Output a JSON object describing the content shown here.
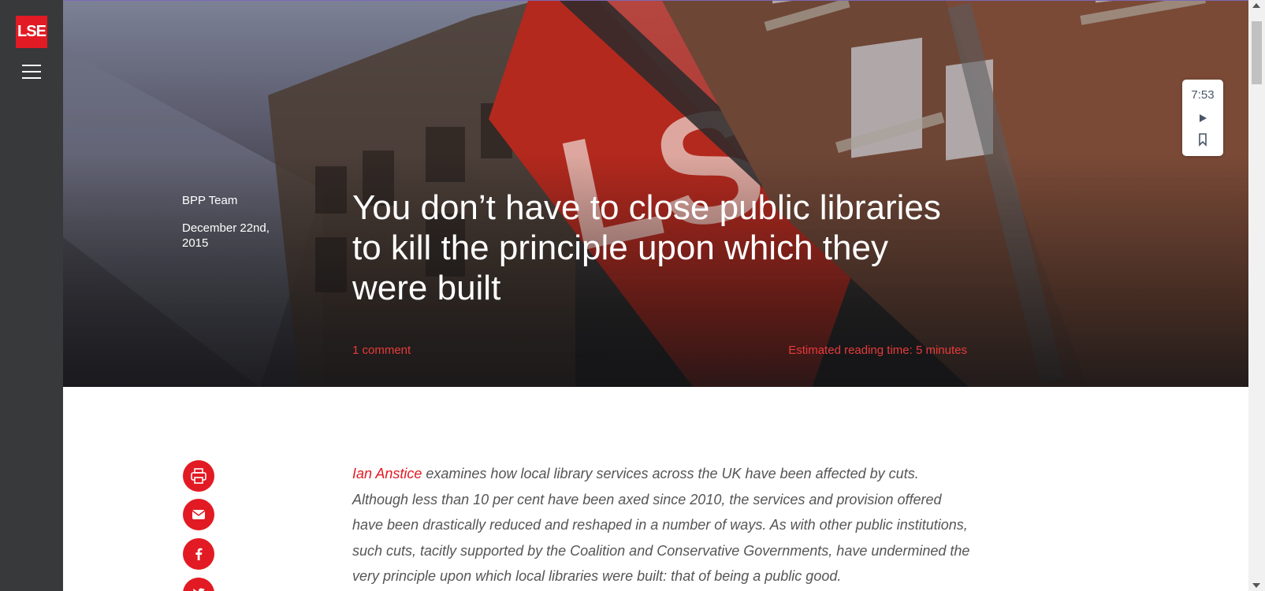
{
  "sidebar": {
    "logo_text": "LSE",
    "menu_icon": "hamburger-menu-icon"
  },
  "article": {
    "author": "BPP Team",
    "date": "December 22nd, 2015",
    "title": "You don’t have to close public libraries to kill the principle upon which they were built",
    "comments_label": "1 comment",
    "reading_time": "Estimated reading time: 5 minutes"
  },
  "audio": {
    "duration": "7:53",
    "play_icon": "play-icon",
    "bookmark_icon": "bookmark-icon"
  },
  "share": [
    {
      "icon": "print-icon"
    },
    {
      "icon": "email-icon"
    },
    {
      "icon": "facebook-icon"
    },
    {
      "icon": "twitter-icon"
    }
  ],
  "intro": {
    "author_link": "Ian Anstice",
    "text": " examines how local library services across the UK have been affected by cuts. Although less than 10 per cent have been axed since 2010, the services and provision offered have been drastically reduced and reshaped in a number of ways. As with other public institutions, such cuts, tacitly supported by the Coalition and Conservative Governments, have undermined the very principle upon which local libraries were built: that of being a public good."
  },
  "colors": {
    "brand_red": "#e21a23",
    "link_red": "#e73b3b",
    "sidebar_dark": "#38393b"
  }
}
